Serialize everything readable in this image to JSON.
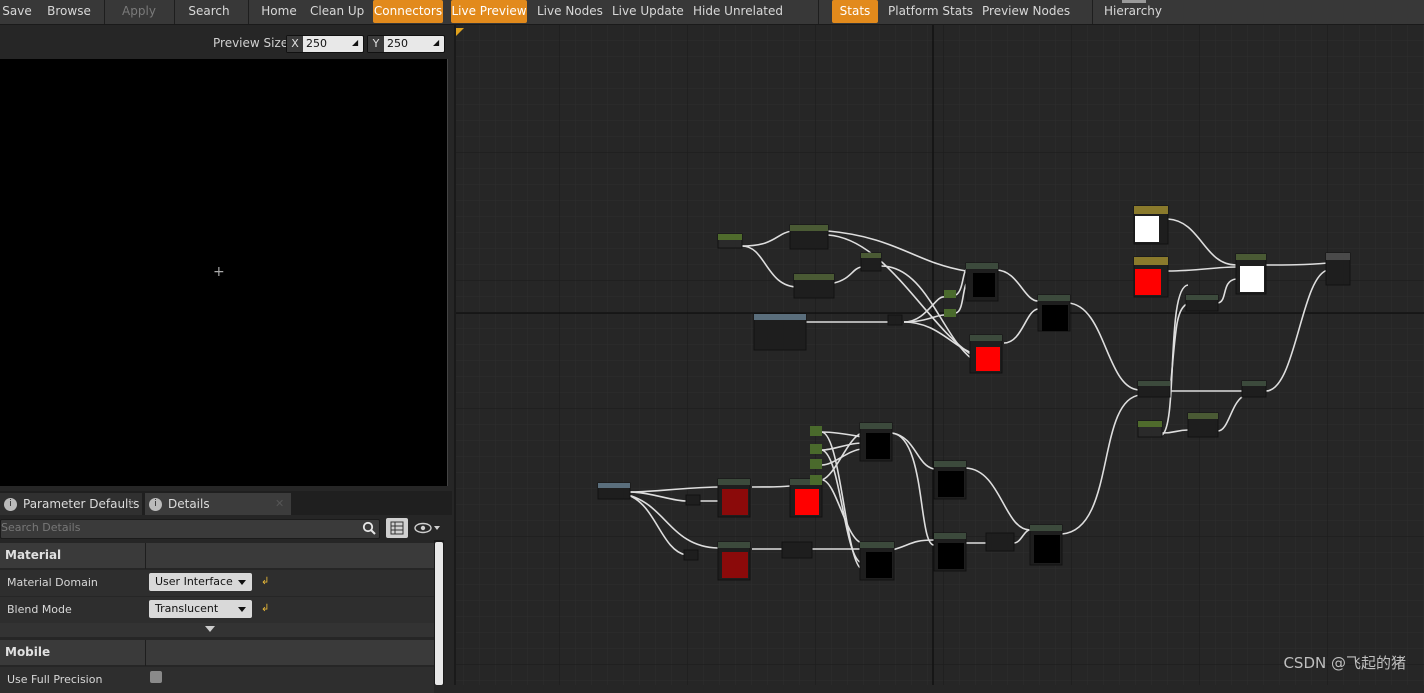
{
  "toolbar": {
    "buttons": [
      {
        "label": "Save"
      },
      {
        "label": "Browse"
      },
      {
        "label": "Apply"
      },
      {
        "label": "Search"
      },
      {
        "label": "Home"
      },
      {
        "label": "Clean Up"
      },
      {
        "label": "Connectors"
      },
      {
        "label": "Live Preview"
      },
      {
        "label": "Live Nodes"
      },
      {
        "label": "Live Update"
      },
      {
        "label": "Hide Unrelated"
      },
      {
        "label": "Stats"
      },
      {
        "label": "Platform Stats"
      },
      {
        "label": "Preview Nodes"
      },
      {
        "label": "Hierarchy"
      }
    ]
  },
  "preview": {
    "size_label": "Preview Size",
    "x_axis": "X",
    "x_value": "250",
    "y_axis": "Y",
    "y_value": "250"
  },
  "details": {
    "tabs": [
      {
        "label": "Parameter Defaults"
      },
      {
        "label": "Details"
      }
    ],
    "search_placeholder": "Search Details",
    "sections": [
      {
        "title": "Material"
      },
      {
        "title": "Mobile"
      }
    ],
    "rows": [
      {
        "label": "Material Domain",
        "value": "User Interface"
      },
      {
        "label": "Blend Mode",
        "value": "Translucent"
      },
      {
        "label": "Use Full Precision"
      }
    ]
  },
  "colors": {
    "accent": "#e28a1c",
    "node_red": "#ff0000",
    "node_dark_red": "#8b0a0a",
    "wire": "#d8d8d8"
  },
  "watermark": "CSDN @飞起的猪"
}
